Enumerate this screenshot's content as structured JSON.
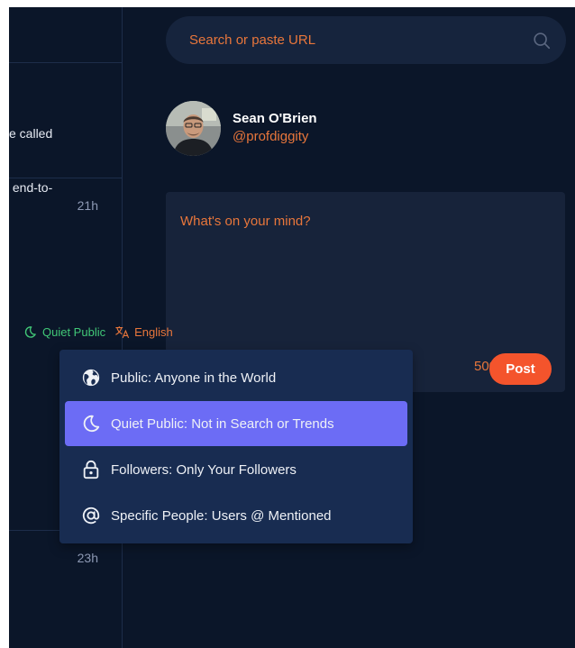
{
  "timeline": {
    "snippet_line1": "e called",
    "snippet_line2": " end-to-",
    "times": [
      "21h",
      "23h"
    ]
  },
  "search": {
    "placeholder": "Search or paste URL"
  },
  "profile": {
    "name": "Sean O'Brien",
    "handle": "@profdiggity"
  },
  "compose": {
    "placeholder": "What's on your mind?",
    "visibility_label": "Quiet Public",
    "language_label": "English",
    "char_count": "500",
    "post_label": "Post"
  },
  "visibility_menu": {
    "items": [
      {
        "label": "Public: Anyone in the World",
        "icon": "globe-icon",
        "selected": false
      },
      {
        "label": "Quiet Public: Not in Search or Trends",
        "icon": "moon-icon",
        "selected": true
      },
      {
        "label": "Followers: Only Your Followers",
        "icon": "lock-icon",
        "selected": false
      },
      {
        "label": "Specific People: Users @ Mentioned",
        "icon": "at-icon",
        "selected": false
      }
    ]
  },
  "colors": {
    "background": "#0b1629",
    "accent_orange": "#e8763b",
    "post_button": "#f4542c",
    "quiet_public_green": "#41c877",
    "menu_bg": "#182c51",
    "menu_selected": "#6c6cf5"
  }
}
